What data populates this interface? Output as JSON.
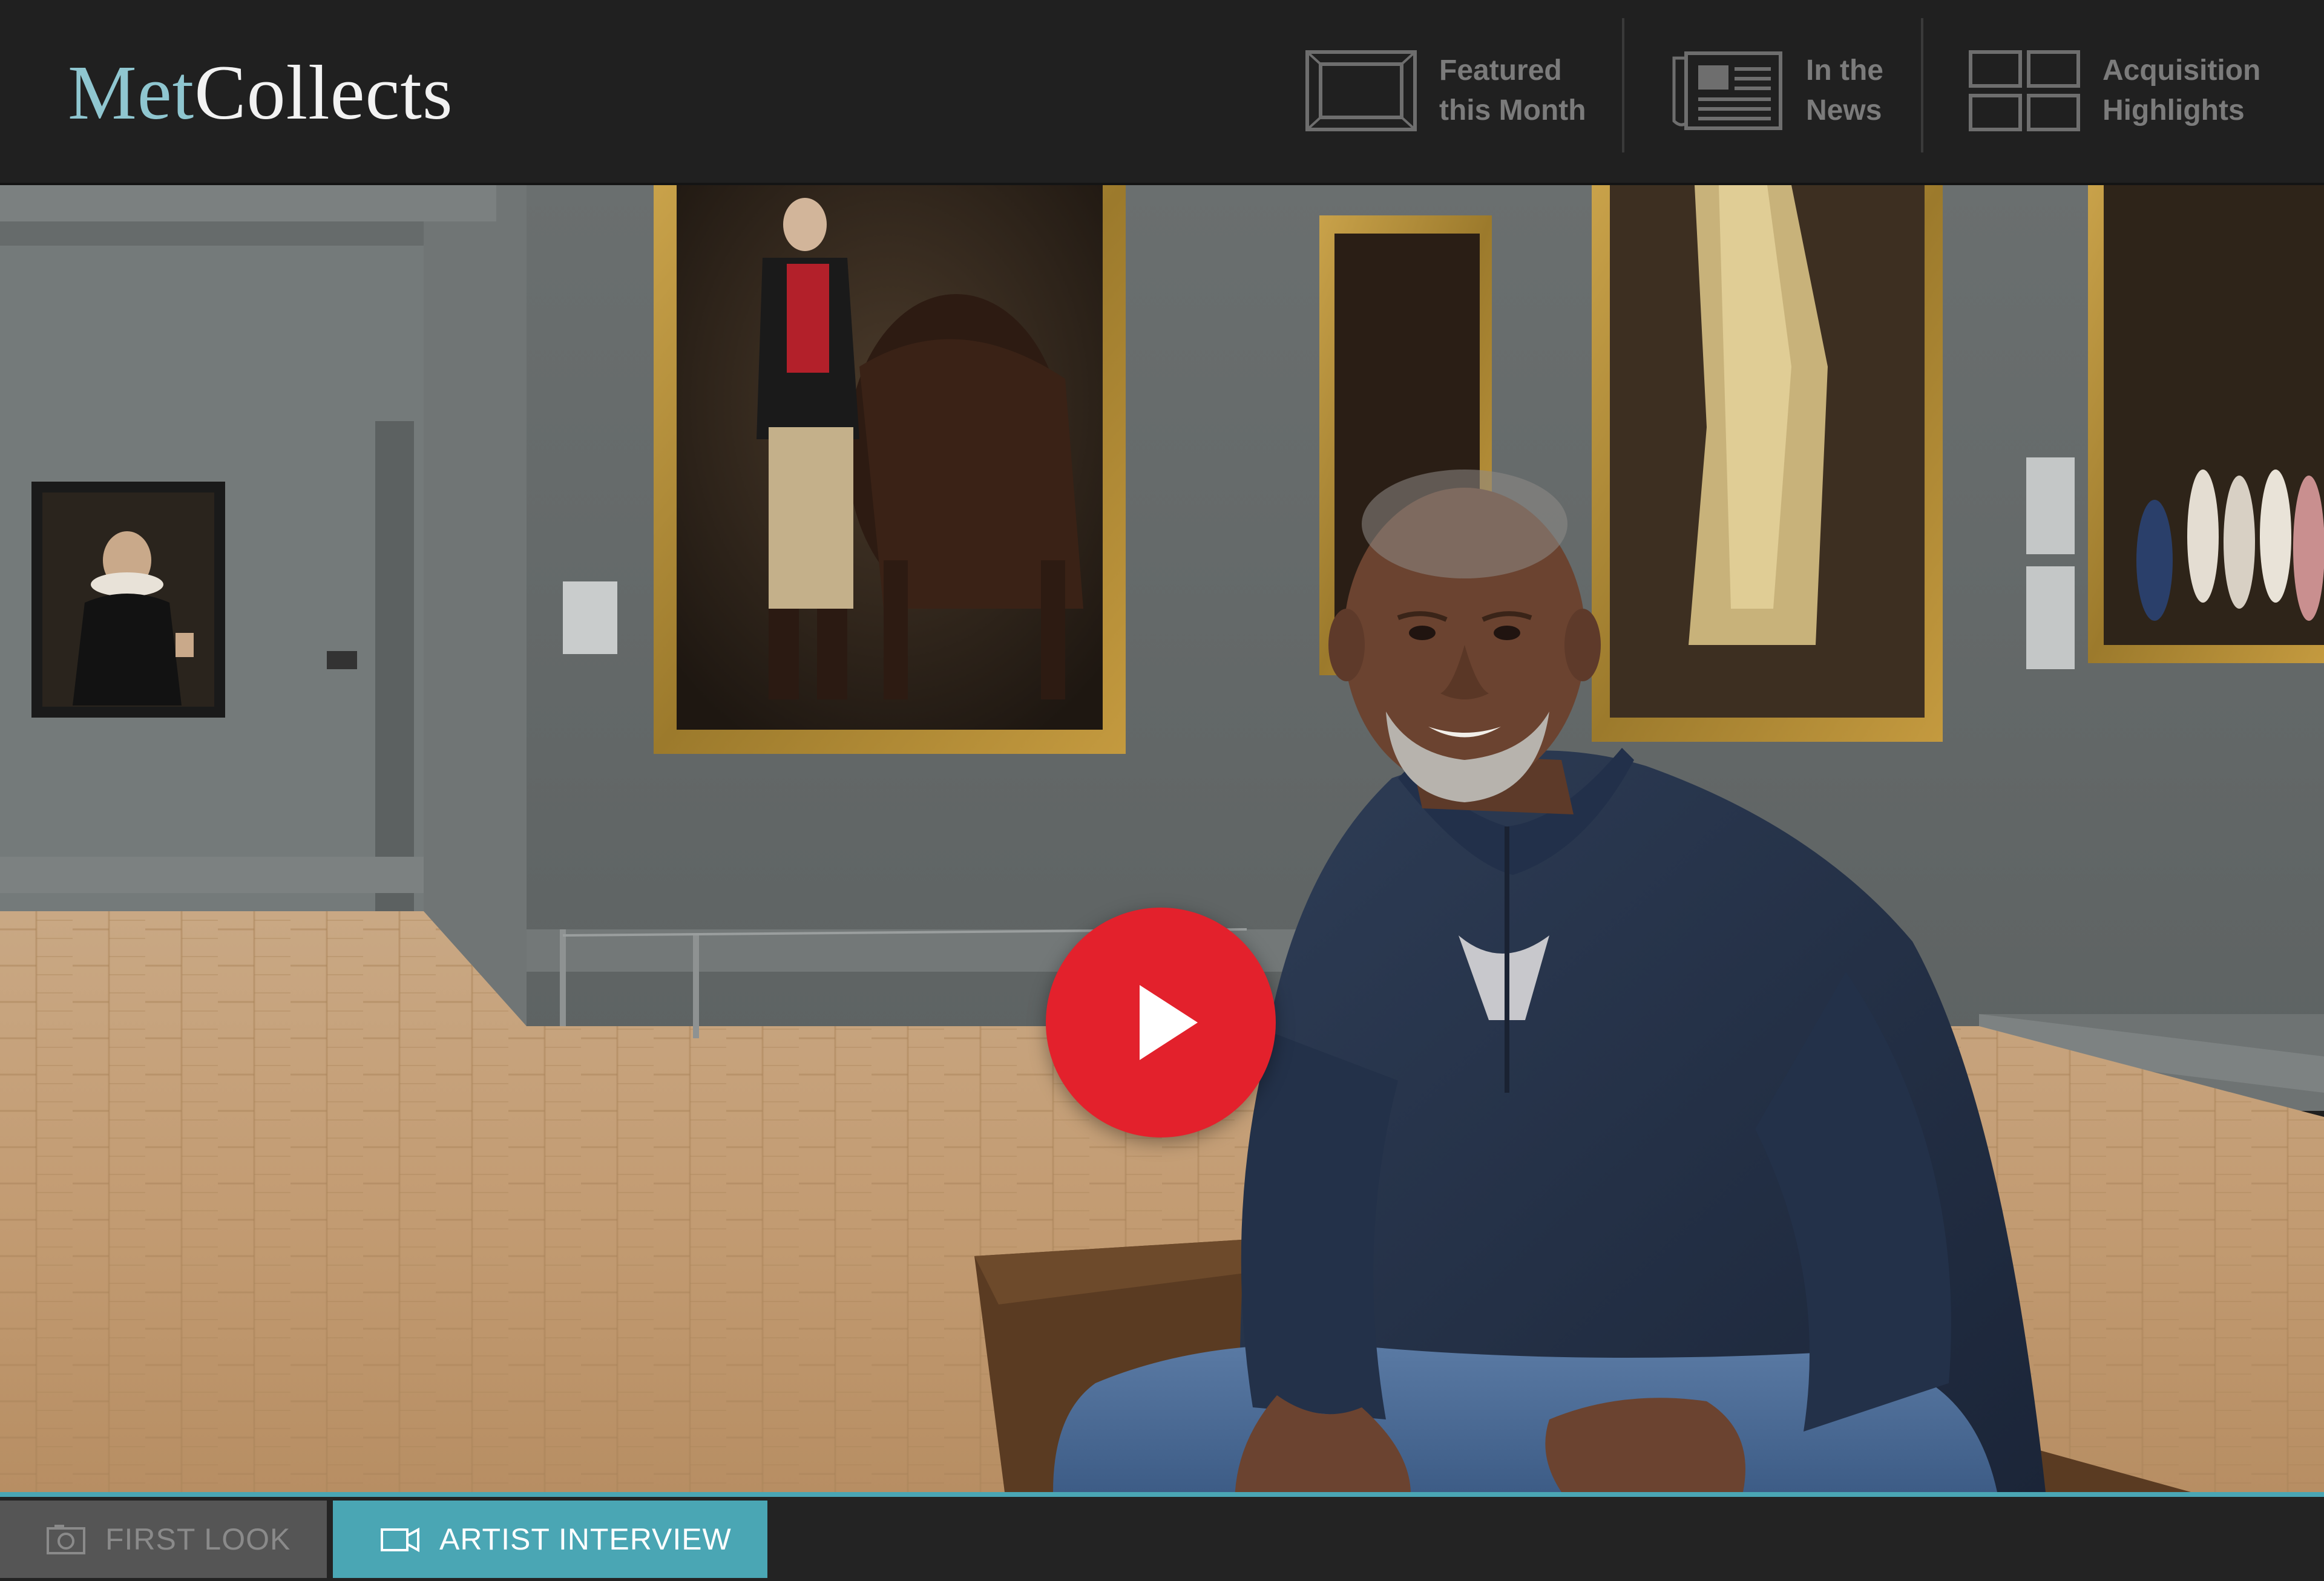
{
  "header": {
    "logo": {
      "part1": "Met",
      "part2": "Collects"
    },
    "nav": [
      {
        "label": "Featured\nthis Month",
        "icon": "frame-icon"
      },
      {
        "label": "In the\nNews",
        "icon": "newspaper-icon"
      },
      {
        "label": "Acquisition\nHighlights",
        "icon": "grid-icon"
      }
    ]
  },
  "video": {
    "play_icon": "play-icon",
    "play_button_color": "#e3212c"
  },
  "tabs": [
    {
      "label": "FIRST LOOK",
      "icon": "camera-icon",
      "active": false
    },
    {
      "label": "ARTIST INTERVIEW",
      "icon": "video-camera-icon",
      "active": true
    }
  ],
  "colors": {
    "accent": "#4aa6b4",
    "header_bg": "#202020",
    "logo_met": "#8fc6d0"
  }
}
